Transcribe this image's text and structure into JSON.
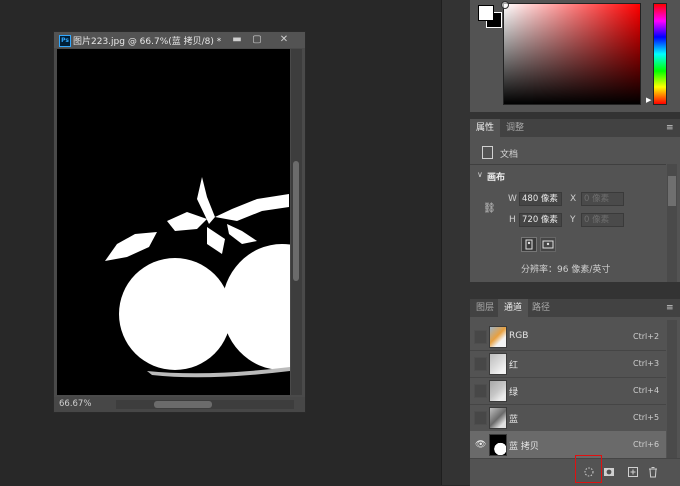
{
  "document": {
    "title": "图片223.jpg @ 66.7%(蓝 拷贝/8) *",
    "zoom": "66.67%",
    "ps_badge": "Ps",
    "minimize": "▬",
    "maximize": "▢",
    "close": "✕"
  },
  "color_panel": {
    "foreground": "#ffffff",
    "background": "#000000",
    "hue": "#ff0000"
  },
  "properties": {
    "tabs": [
      "属性",
      "调整"
    ],
    "doc_label": "文档",
    "section": "画布",
    "width_label": "W",
    "width_value": "480 像素",
    "height_label": "H",
    "height_value": "720 像素",
    "x_label": "X",
    "x_placeholder": "0 像素",
    "y_label": "Y",
    "y_placeholder": "0 像素",
    "resolution": "分辨率：96 像素/英寸"
  },
  "channels_panel": {
    "tabs": [
      "图层",
      "通道",
      "路径"
    ],
    "rows": [
      {
        "name": "RGB",
        "shortcut": "Ctrl+2",
        "visible": false
      },
      {
        "name": "红",
        "shortcut": "Ctrl+3",
        "visible": false
      },
      {
        "name": "绿",
        "shortcut": "Ctrl+4",
        "visible": false
      },
      {
        "name": "蓝",
        "shortcut": "Ctrl+5",
        "visible": false
      },
      {
        "name": "蓝 拷贝",
        "shortcut": "Ctrl+6",
        "visible": true
      }
    ],
    "eye_glyph": "👁"
  },
  "icons": {
    "menu": "≡",
    "link": "⛓",
    "expand": "∨",
    "new_channel": "+",
    "delete": "🗑"
  }
}
